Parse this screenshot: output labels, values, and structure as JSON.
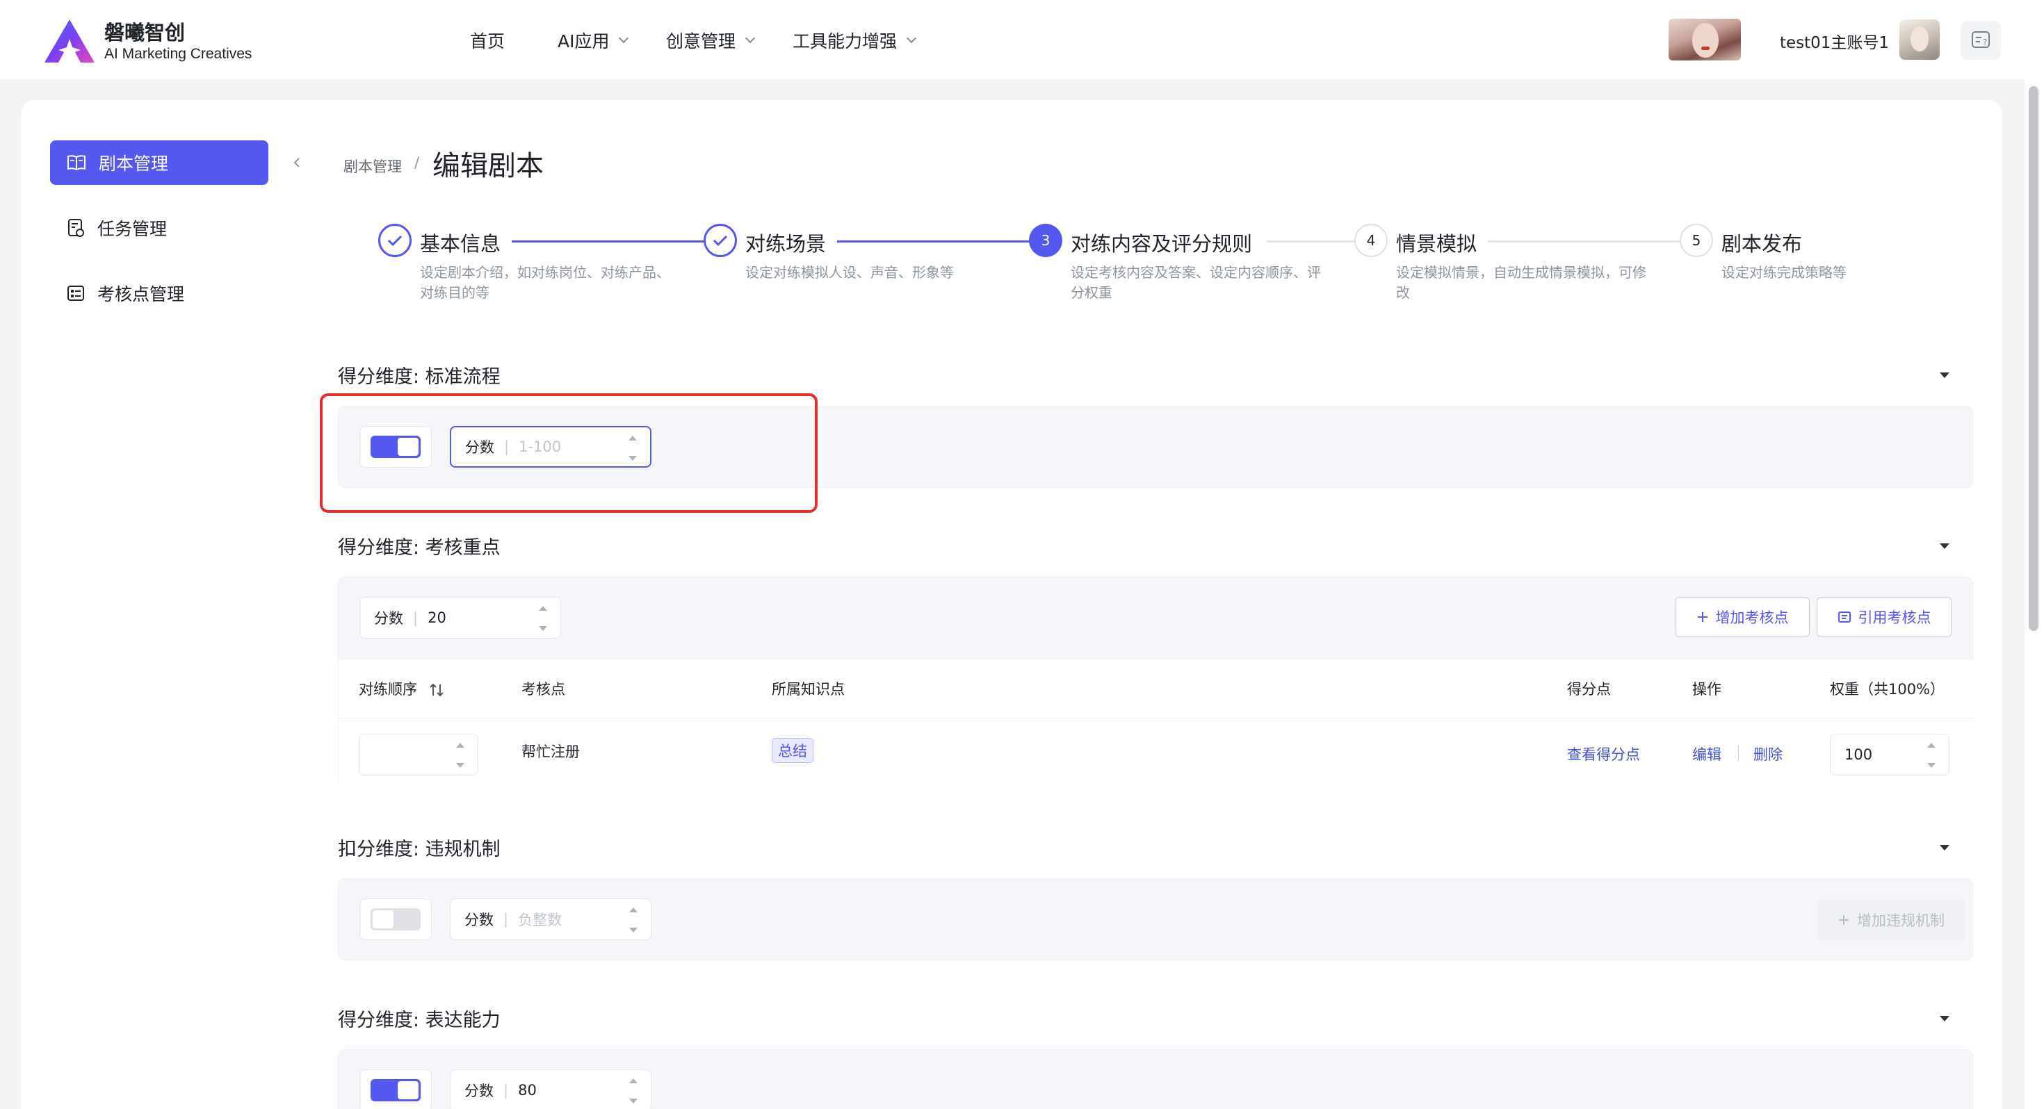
{
  "brand": {
    "name_cn": "磐曦智创",
    "name_en": "AI Marketing Creatives"
  },
  "nav": [
    {
      "label": "首页",
      "has_dropdown": false
    },
    {
      "label": "AI应用",
      "has_dropdown": true
    },
    {
      "label": "创意管理",
      "has_dropdown": true
    },
    {
      "label": "工具能力增强",
      "has_dropdown": true
    }
  ],
  "user": {
    "name": "test01主账号1"
  },
  "sidebar": {
    "items": [
      {
        "label": "剧本管理",
        "icon": "book-icon",
        "active": true
      },
      {
        "label": "任务管理",
        "icon": "task-icon",
        "active": false
      },
      {
        "label": "考核点管理",
        "icon": "checklist-icon",
        "active": false
      }
    ]
  },
  "breadcrumb": {
    "root": "剧本管理",
    "separator": "/",
    "current": "编辑剧本"
  },
  "steps": [
    {
      "index": "1",
      "title": "基本信息",
      "desc": "设定剧本介绍，如对练岗位、对练产品、对练目的等",
      "status": "done"
    },
    {
      "index": "2",
      "title": "对练场景",
      "desc": "设定对练模拟人设、声音、形象等",
      "status": "done"
    },
    {
      "index": "3",
      "title": "对练内容及评分规则",
      "desc": "设定考核内容及答案、设定内容顺序、评分权重",
      "status": "current"
    },
    {
      "index": "4",
      "title": "情景模拟",
      "desc": "设定模拟情景，自动生成情景模拟，可修改",
      "status": "todo"
    },
    {
      "index": "5",
      "title": "剧本发布",
      "desc": "设定对练完成策略等",
      "status": "todo"
    }
  ],
  "sections": {
    "standard_process": {
      "title": "得分维度: 标准流程",
      "enabled": true,
      "score_label": "分数",
      "score_value": "",
      "score_placeholder": "1-100"
    },
    "key_points": {
      "title": "得分维度: 考核重点",
      "score_label": "分数",
      "score_value": "20",
      "add_button": "增加考核点",
      "cite_button": "引用考核点",
      "columns": [
        "对练顺序",
        "考核点",
        "所属知识点",
        "得分点",
        "操作",
        "权重（共100%）"
      ],
      "rows": [
        {
          "order": "",
          "point": "帮忙注册",
          "knowledge_tag": "总结",
          "score_link": "查看得分点",
          "edit": "编辑",
          "delete": "删除",
          "weight": "100"
        }
      ]
    },
    "violation": {
      "title": "扣分维度: 违规机制",
      "enabled": false,
      "score_label": "分数",
      "score_value": "",
      "score_placeholder": "负整数",
      "add_button": "增加违规机制"
    },
    "expression": {
      "title": "得分维度: 表达能力",
      "enabled": true,
      "score_label": "分数",
      "score_value": "80"
    }
  },
  "colors": {
    "accent": "#5457f0",
    "highlight_box": "#e52f2f",
    "link": "#3f51d8"
  }
}
